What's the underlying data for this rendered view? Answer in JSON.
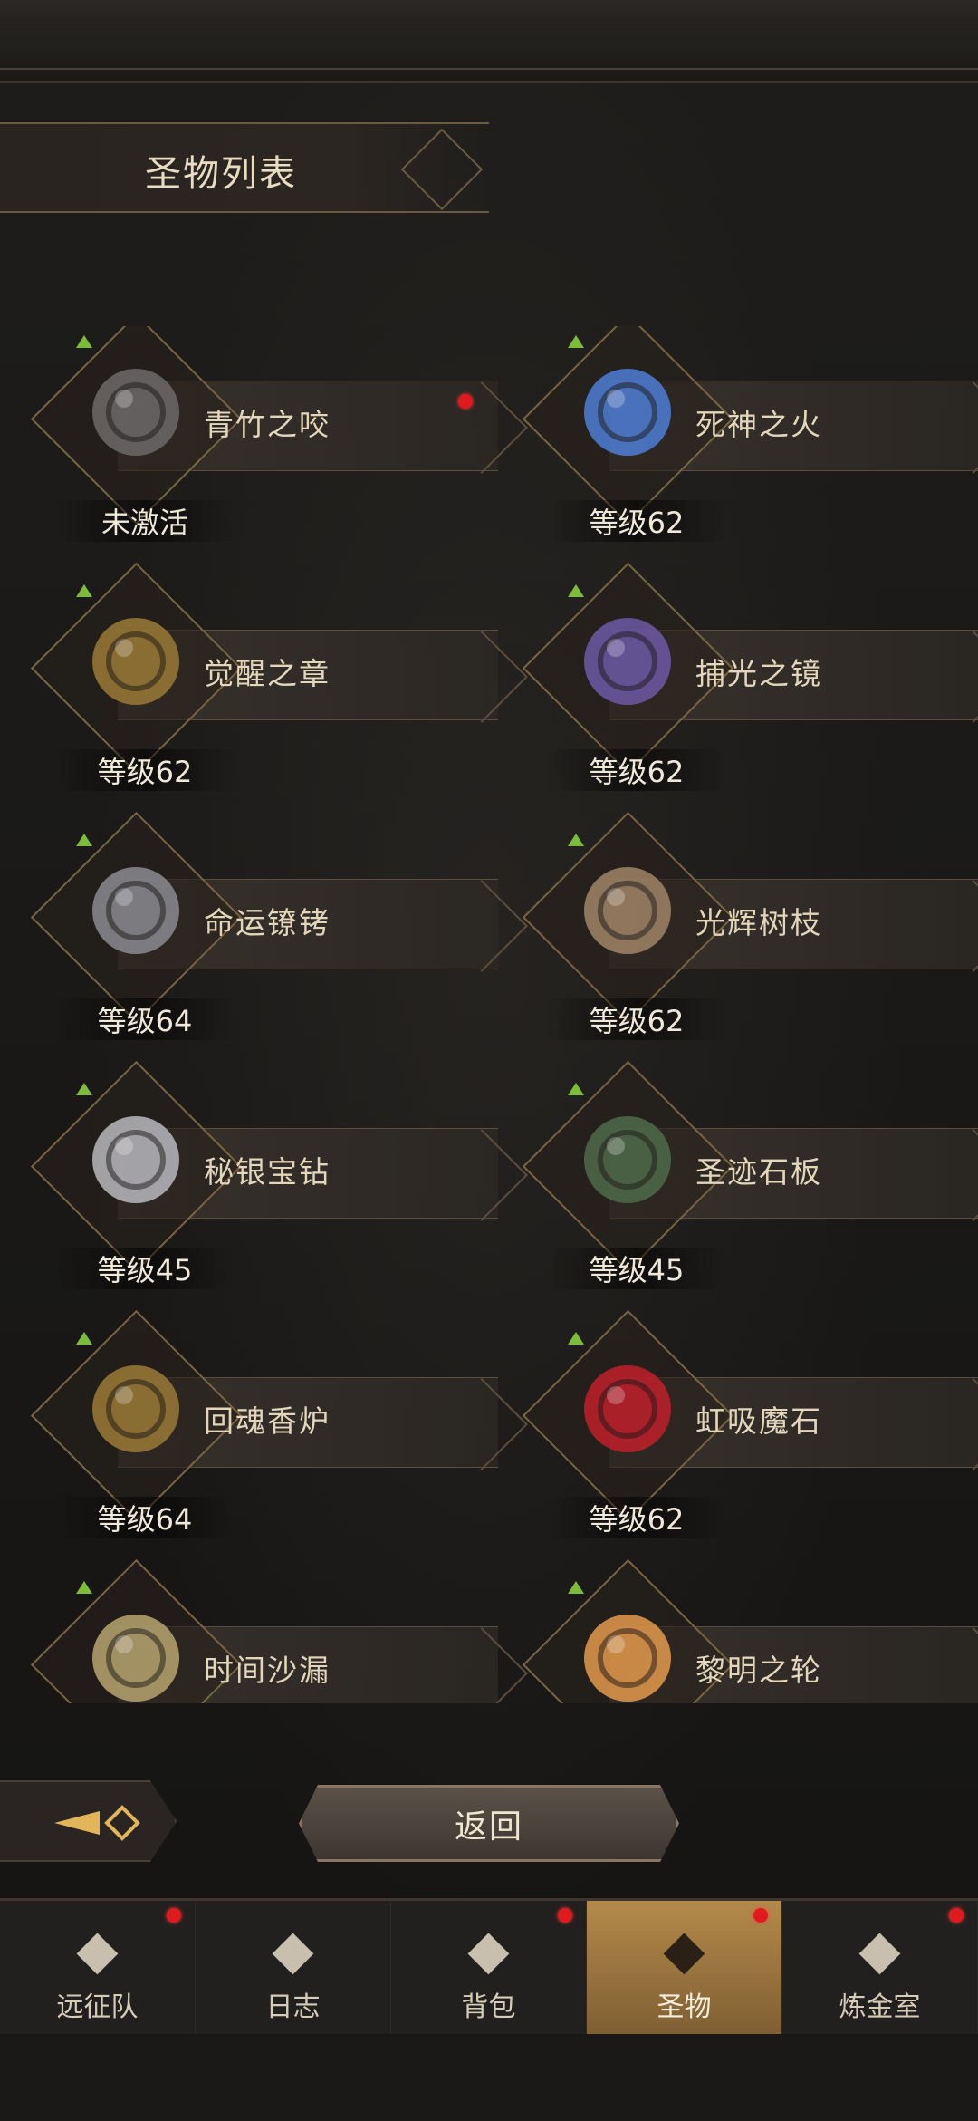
{
  "header": {
    "title": "圣物列表"
  },
  "relics": [
    {
      "name": "青竹之咬",
      "status": "未激活",
      "has_dot": true,
      "icon": "whip-icon",
      "color": "#6c6a68"
    },
    {
      "name": "死神之火",
      "status": "等级62",
      "has_dot": false,
      "icon": "ghost-hand-icon",
      "color": "#4f7fd6"
    },
    {
      "name": "觉醒之章",
      "status": "等级62",
      "has_dot": false,
      "icon": "book-icon",
      "color": "#9a7a36"
    },
    {
      "name": "捕光之镜",
      "status": "等级62",
      "has_dot": false,
      "icon": "mirror-icon",
      "color": "#6c5aa6"
    },
    {
      "name": "命运镣铐",
      "status": "等级64",
      "has_dot": false,
      "icon": "shackles-icon",
      "color": "#8b8b90"
    },
    {
      "name": "光辉树枝",
      "status": "等级62",
      "has_dot": false,
      "icon": "branch-icon",
      "color": "#a08566"
    },
    {
      "name": "秘银宝钻",
      "status": "等级45",
      "has_dot": false,
      "icon": "pyramid-icon",
      "color": "#b9b9bd"
    },
    {
      "name": "圣迹石板",
      "status": "等级45",
      "has_dot": false,
      "icon": "tablet-icon",
      "color": "#4f6b4a"
    },
    {
      "name": "回魂香炉",
      "status": "等级64",
      "has_dot": false,
      "icon": "censer-icon",
      "color": "#9a7a36"
    },
    {
      "name": "虹吸魔石",
      "status": "等级62",
      "has_dot": false,
      "icon": "red-crystal-icon",
      "color": "#c0202a"
    },
    {
      "name": "时间沙漏",
      "status": "",
      "has_dot": false,
      "icon": "hourglass-icon",
      "color": "#b7a46e"
    },
    {
      "name": "黎明之轮",
      "status": "",
      "has_dot": false,
      "icon": "sun-wheel-icon",
      "color": "#e49a4c"
    }
  ],
  "controls": {
    "back_label": "返回"
  },
  "nav": [
    {
      "label": "远征队",
      "icon": "helmet-icon",
      "active": false,
      "has_dot": true
    },
    {
      "label": "日志",
      "icon": "scroll-icon",
      "active": false,
      "has_dot": false
    },
    {
      "label": "背包",
      "icon": "bag-icon",
      "active": false,
      "has_dot": true
    },
    {
      "label": "圣物",
      "icon": "torch-icon",
      "active": true,
      "has_dot": true
    },
    {
      "label": "炼金室",
      "icon": "alchemy-icon",
      "active": false,
      "has_dot": true
    }
  ]
}
